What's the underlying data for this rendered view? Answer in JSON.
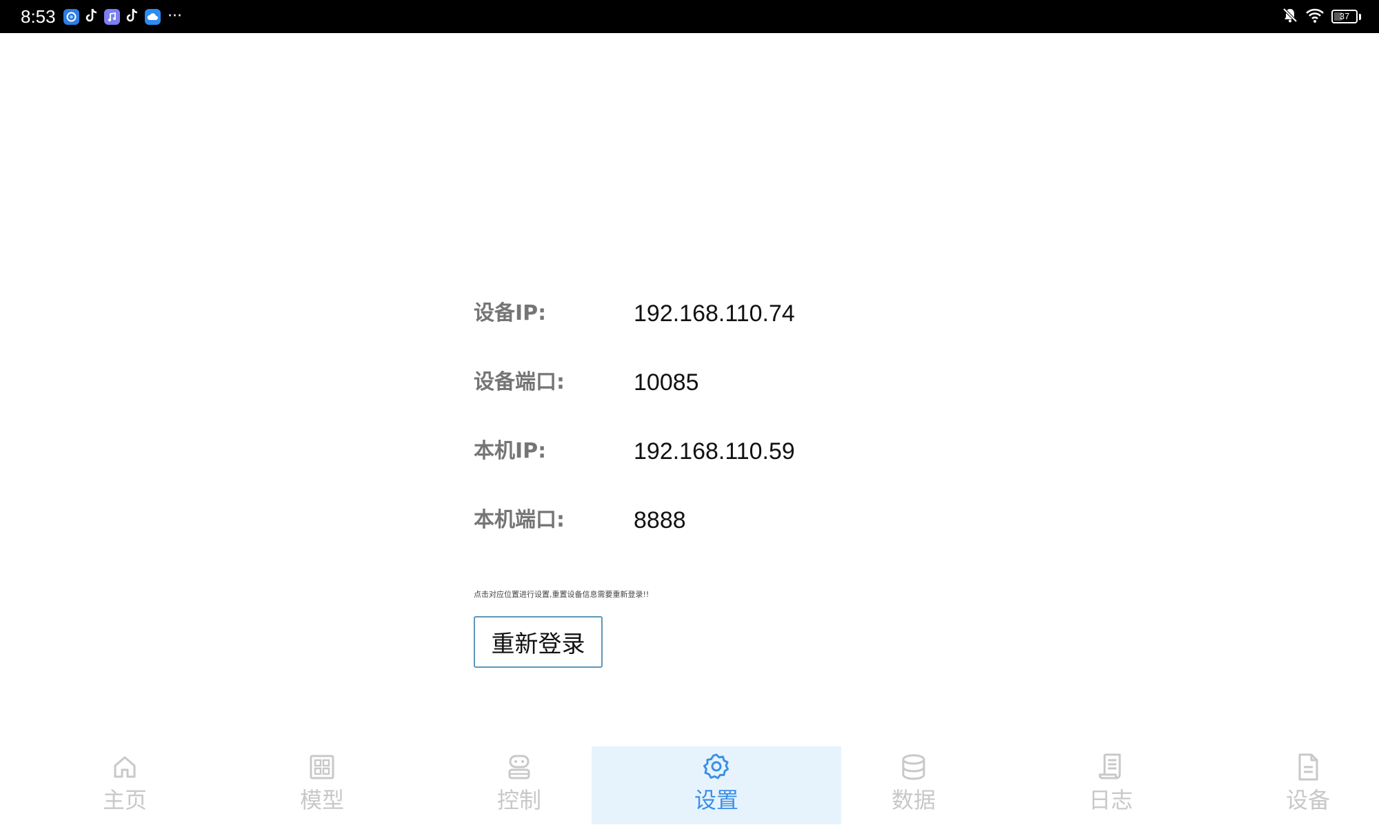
{
  "status_bar": {
    "time": "8:53",
    "overflow": "···",
    "battery_level": "37",
    "notification_icons": [
      "app-icon",
      "tiktok-icon",
      "music-icon",
      "tiktok-icon",
      "cloud-icon"
    ],
    "right_icons": [
      "bell-off-icon",
      "wifi-icon",
      "battery-icon"
    ]
  },
  "settings": {
    "device_ip": {
      "label": "设备IP:",
      "value": "192.168.110.74"
    },
    "device_port": {
      "label": "设备端口:",
      "value": "10085"
    },
    "local_ip": {
      "label": "本机IP:",
      "value": "192.168.110.59"
    },
    "local_port": {
      "label": "本机端口:",
      "value": "8888"
    },
    "hint": "点击对应位置进行设置,重置设备信息需要重新登录!!",
    "relogin_label": "重新登录"
  },
  "nav": {
    "active": "settings",
    "active_color": "#3b8fe6",
    "active_bg": "#e6f3fd",
    "inactive_color": "#c8c8c8",
    "items": [
      {
        "id": "home",
        "label": "主页",
        "icon": "home-icon"
      },
      {
        "id": "model",
        "label": "模型",
        "icon": "grid-icon"
      },
      {
        "id": "control",
        "label": "控制",
        "icon": "robot-icon"
      },
      {
        "id": "settings",
        "label": "设置",
        "icon": "gear-icon"
      },
      {
        "id": "data",
        "label": "数据",
        "icon": "database-icon"
      },
      {
        "id": "log",
        "label": "日志",
        "icon": "scroll-icon"
      },
      {
        "id": "device",
        "label": "设备",
        "icon": "document-icon"
      }
    ]
  }
}
